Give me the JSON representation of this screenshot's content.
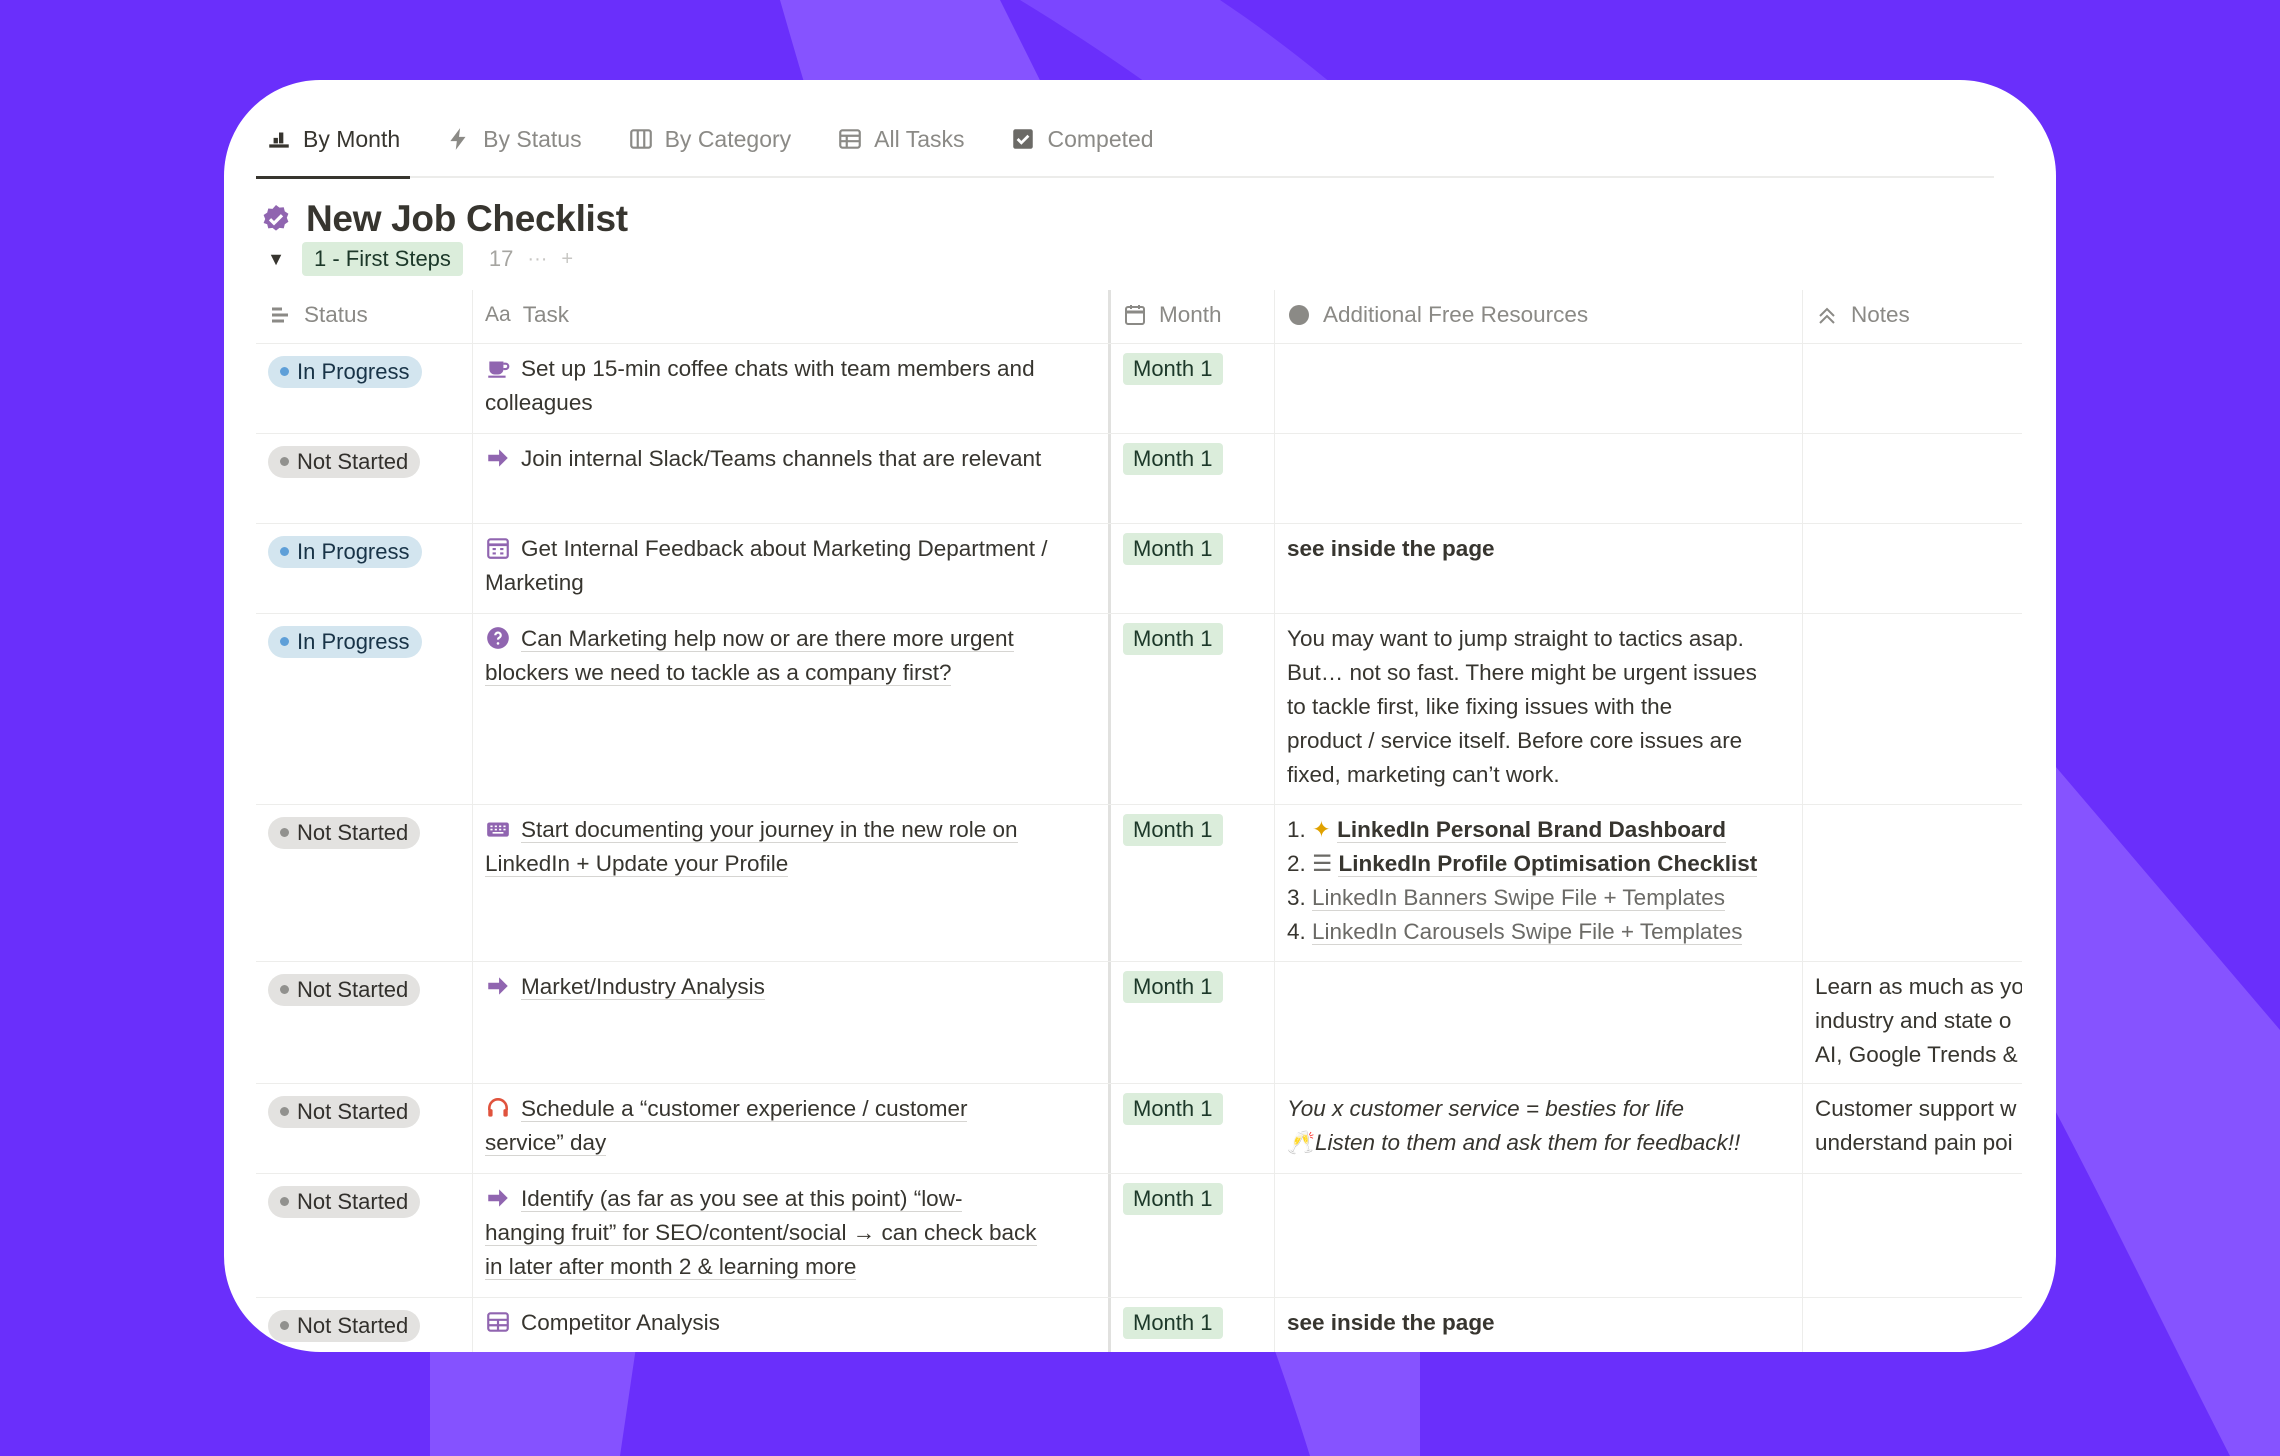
{
  "tabs": [
    {
      "label": "By Month",
      "icon": "bar-chart-icon",
      "active": true
    },
    {
      "label": "By Status",
      "icon": "lightning-icon",
      "active": false
    },
    {
      "label": "By Category",
      "icon": "board-columns-icon",
      "active": false
    },
    {
      "label": "All Tasks",
      "icon": "table-icon",
      "active": false
    },
    {
      "label": "Competed",
      "icon": "checkbox-icon",
      "active": false
    }
  ],
  "page": {
    "title": "New Job Checklist",
    "title_icon": "verified-badge-icon"
  },
  "group": {
    "label": "1 - First Steps",
    "count": "17",
    "more": "···",
    "add": "+"
  },
  "columns": {
    "status": "Status",
    "task": "Task",
    "month": "Month",
    "resources": "Additional Free Resources",
    "notes": "Notes"
  },
  "colors": {
    "background": "#6a2ffb",
    "in_progress_bg": "#d3e5ef",
    "not_started_bg": "#e3e2e0",
    "month_bg": "#dbeddb",
    "task_icon": "#9065b0"
  },
  "rows": [
    {
      "status": "In Progress",
      "task_icon": "coffee-cup-icon",
      "task_lines": [
        "Set up 15-min coffee chats with team members and",
        "colleagues"
      ],
      "month": "Month 1",
      "resources": [],
      "notes": []
    },
    {
      "status": "Not Started",
      "task_icon": "arrow-right-icon",
      "task_lines": [
        "Join internal Slack/Teams channels that are relevant"
      ],
      "month": "Month 1",
      "resources": [],
      "notes": []
    },
    {
      "status": "In Progress",
      "task_icon": "calendar-icon",
      "task_lines": [
        "Get Internal Feedback about Marketing Department /",
        "Marketing"
      ],
      "month": "Month 1",
      "resources": [
        "see inside the page"
      ],
      "notes": []
    },
    {
      "status": "In Progress",
      "task_icon": "question-circle-icon",
      "task_lines": [
        "Can Marketing help now or are there more urgent",
        "blockers we need to tackle as a company first?"
      ],
      "month": "Month 1",
      "resources": [
        "You may want to jump straight to tactics asap.",
        "But… not so fast. There might be urgent issues",
        "to tackle first, like fixing issues with the",
        "product / service itself. Before core issues are",
        "fixed, marketing can’t work."
      ],
      "notes": []
    },
    {
      "status": "Not Started",
      "task_icon": "keyboard-icon",
      "task_lines": [
        "Start documenting your journey in the new role on",
        "LinkedIn + Update your Profile"
      ],
      "month": "Month 1",
      "resources": [
        {
          "num": "1.",
          "icon": "sparkle-hand-icon",
          "text": "LinkedIn Personal Brand Dashboard"
        },
        {
          "num": "2.",
          "icon": "checklist-icon",
          "text": "LinkedIn Profile Optimisation Checklist"
        },
        {
          "num": "3.",
          "icon": "",
          "text": "LinkedIn Banners Swipe File + Templates"
        },
        {
          "num": "4.",
          "icon": "",
          "text": "LinkedIn Carousels Swipe File + Templates"
        }
      ],
      "notes": []
    },
    {
      "status": "Not Started",
      "task_icon": "arrow-right-icon",
      "task_lines": [
        "Market/Industry Analysis"
      ],
      "month": "Month 1",
      "resources": [],
      "notes": [
        "Learn as much as yo",
        "industry and state o",
        "AI, Google Trends &"
      ]
    },
    {
      "status": "Not Started",
      "task_icon": "headset-icon",
      "task_lines": [
        "Schedule a “customer experience / customer",
        "service” day"
      ],
      "month": "Month 1",
      "resources": [
        "You x customer service = besties for life",
        "Listen to them and ask them for feedback!!"
      ],
      "resources_icon": "cheers-icon",
      "notes": [
        "Customer support w",
        "understand pain poi"
      ]
    },
    {
      "status": "Not Started",
      "task_icon": "arrow-right-icon",
      "task_lines": [
        "Identify (as far as you see at this point) “low-",
        "hanging fruit” for SEO/content/social → can check back",
        "in later after month 2 & learning more"
      ],
      "month": "Month 1",
      "resources": [],
      "notes": []
    },
    {
      "status": "Not Started",
      "task_icon": "table-grid-icon",
      "task_lines": [
        "Competitor Analysis"
      ],
      "month": "Month 1",
      "resources": [
        "see inside the page"
      ],
      "notes": []
    }
  ]
}
